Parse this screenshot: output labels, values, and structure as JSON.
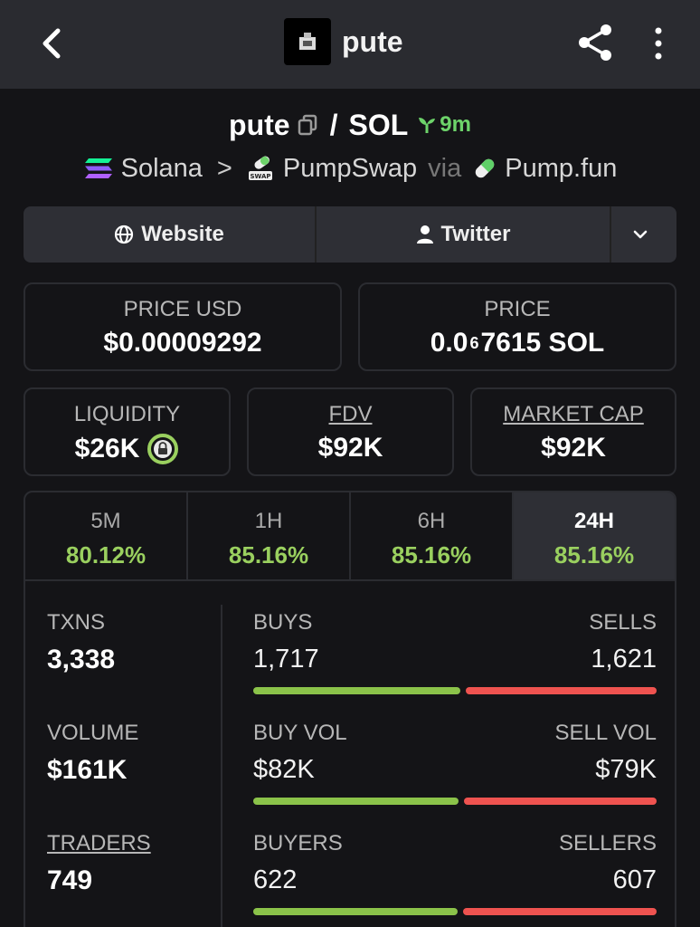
{
  "header": {
    "title": "pute",
    "icons": {
      "back": "back-arrow-icon",
      "share": "share-icon",
      "more": "kebab-menu-icon",
      "logo": "token-logo"
    }
  },
  "pair": {
    "base": "pute",
    "separator": "/",
    "quote": "SOL",
    "age": "9m",
    "age_icon": "sprout-icon",
    "age_color": "#6dd36a"
  },
  "route": {
    "chain": "Solana",
    "chevron": ">",
    "dex": "PumpSwap",
    "via": "via",
    "launchpad": "Pump.fun"
  },
  "links": {
    "website": "Website",
    "twitter": "Twitter"
  },
  "prices": {
    "price_usd_label": "PRICE USD",
    "price_usd": "$0.00009292",
    "price_label": "PRICE",
    "price_sol_prefix": "0.0",
    "price_sol_sub": "6",
    "price_sol_suffix": "7615 SOL"
  },
  "metrics": {
    "liquidity_label": "LIQUIDITY",
    "liquidity": "$26K",
    "fdv_label": "FDV",
    "fdv": "$92K",
    "mcap_label": "MARKET CAP",
    "mcap": "$92K"
  },
  "tabs": [
    {
      "label": "5M",
      "value": "80.12%"
    },
    {
      "label": "1H",
      "value": "85.16%"
    },
    {
      "label": "6H",
      "value": "85.16%"
    },
    {
      "label": "24H",
      "value": "85.16%",
      "active": true
    }
  ],
  "stats": {
    "txns_label": "TXNS",
    "txns": "3,338",
    "volume_label": "VOLUME",
    "volume": "$161K",
    "traders_label": "TRADERS",
    "traders": "749",
    "buys_label": "BUYS",
    "buys": "1,717",
    "sells_label": "SELLS",
    "sells": "1,621",
    "buy_vol_label": "BUY VOL",
    "buy_vol": "$82K",
    "sell_vol_label": "SELL VOL",
    "sell_vol": "$79K",
    "buyers_label": "BUYERS",
    "buyers": "622",
    "sellers_label": "SELLERS",
    "sellers": "607",
    "buy_share": 0.514,
    "buy_vol_share": 0.509,
    "buyer_share": 0.506,
    "buy_color": "#8bc34a",
    "sell_color": "#ef5350"
  }
}
